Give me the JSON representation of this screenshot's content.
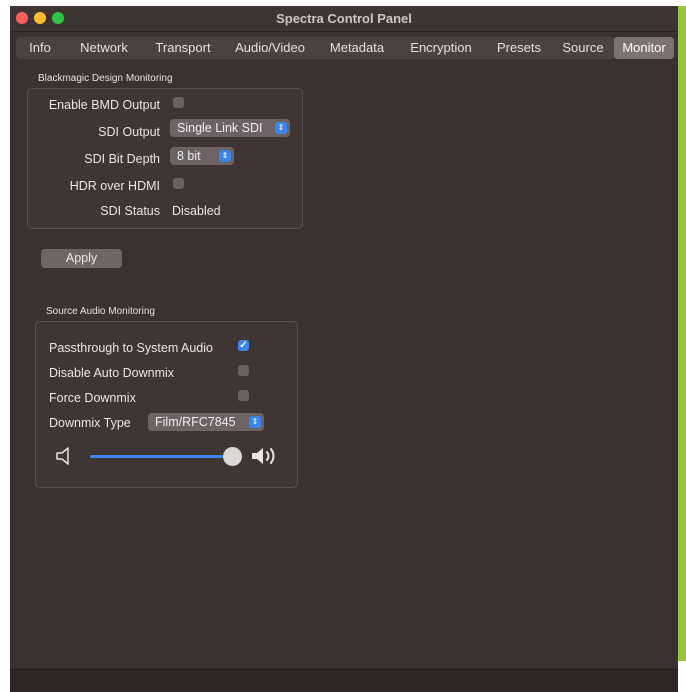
{
  "window": {
    "title": "Spectra Control Panel"
  },
  "tabs": [
    {
      "label": "Info"
    },
    {
      "label": "Network"
    },
    {
      "label": "Transport"
    },
    {
      "label": "Audio/Video"
    },
    {
      "label": "Metadata"
    },
    {
      "label": "Encryption"
    },
    {
      "label": "Presets"
    },
    {
      "label": "Source"
    },
    {
      "label": "Monitor",
      "active": true
    }
  ],
  "bmd": {
    "section_title": "Blackmagic Design Monitoring",
    "enable_output_label": "Enable BMD Output",
    "enable_output_checked": false,
    "sdi_output_label": "SDI Output",
    "sdi_output_value": "Single Link SDI",
    "sdi_bit_depth_label": "SDI Bit Depth",
    "sdi_bit_depth_value": "8 bit",
    "hdr_label": "HDR over HDMI",
    "hdr_checked": false,
    "sdi_status_label": "SDI Status",
    "sdi_status_value": "Disabled"
  },
  "apply_label": "Apply",
  "audio": {
    "section_title": "Source Audio Monitoring",
    "passthrough_label": "Passthrough to System Audio",
    "passthrough_checked": true,
    "disable_downmix_label": "Disable Auto Downmix",
    "disable_downmix_checked": false,
    "force_downmix_label": "Force Downmix",
    "force_downmix_checked": false,
    "downmix_type_label": "Downmix Type",
    "downmix_type_value": "Film/RFC7845",
    "volume_level": 1.0
  },
  "icons": {
    "volume_low": "speaker-low-icon",
    "volume_high": "speaker-high-icon"
  },
  "colors": {
    "accent": "#3a86f0",
    "window_bg": "#3a3130",
    "close": "#ff5f57",
    "minimize": "#febc2e",
    "maximize": "#28c840"
  }
}
